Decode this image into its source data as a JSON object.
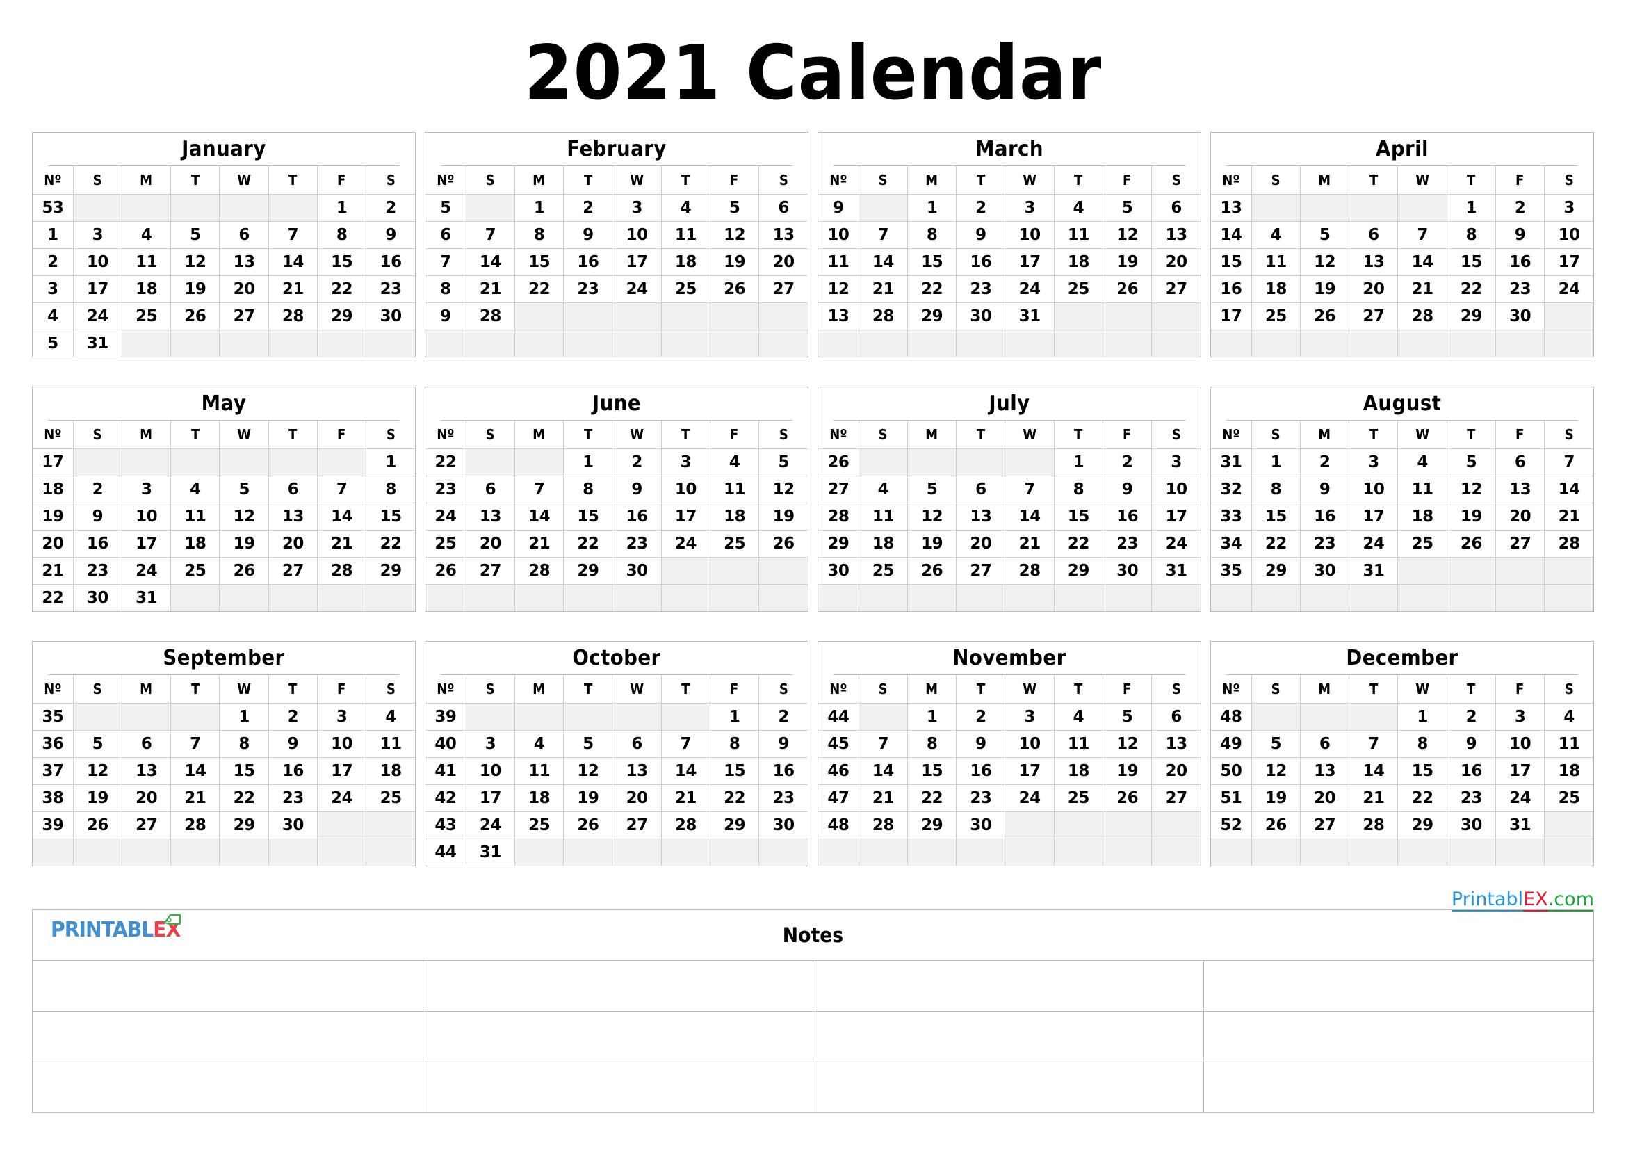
{
  "title": "2021 Calendar",
  "colors": {
    "sunday": "#c1272d",
    "saturday": "#1b75bb",
    "grid": "#bcbcbc",
    "blank_cell": "#f1f1f1",
    "logo_blue": "#3f8fd2",
    "logo_red": "#e8424c",
    "logo_green": "#3fae49",
    "watermark_blue": "#2196e0",
    "watermark_red": "#e8192c",
    "watermark_green": "#1aa536"
  },
  "weekday_headers": [
    "Nº",
    "S",
    "M",
    "T",
    "W",
    "T",
    "F",
    "S"
  ],
  "months": [
    {
      "name": "January",
      "weeks": [
        {
          "no": "53",
          "days": [
            "",
            "",
            "",
            "",
            "",
            "1",
            "2"
          ]
        },
        {
          "no": "1",
          "days": [
            "3",
            "4",
            "5",
            "6",
            "7",
            "8",
            "9"
          ]
        },
        {
          "no": "2",
          "days": [
            "10",
            "11",
            "12",
            "13",
            "14",
            "15",
            "16"
          ]
        },
        {
          "no": "3",
          "days": [
            "17",
            "18",
            "19",
            "20",
            "21",
            "22",
            "23"
          ]
        },
        {
          "no": "4",
          "days": [
            "24",
            "25",
            "26",
            "27",
            "28",
            "29",
            "30"
          ]
        },
        {
          "no": "5",
          "days": [
            "31",
            "",
            "",
            "",
            "",
            "",
            ""
          ]
        }
      ]
    },
    {
      "name": "February",
      "weeks": [
        {
          "no": "5",
          "days": [
            "",
            "1",
            "2",
            "3",
            "4",
            "5",
            "6"
          ]
        },
        {
          "no": "6",
          "days": [
            "7",
            "8",
            "9",
            "10",
            "11",
            "12",
            "13"
          ]
        },
        {
          "no": "7",
          "days": [
            "14",
            "15",
            "16",
            "17",
            "18",
            "19",
            "20"
          ]
        },
        {
          "no": "8",
          "days": [
            "21",
            "22",
            "23",
            "24",
            "25",
            "26",
            "27"
          ]
        },
        {
          "no": "9",
          "days": [
            "28",
            "",
            "",
            "",
            "",
            "",
            ""
          ]
        },
        {
          "no": "",
          "days": [
            "",
            "",
            "",
            "",
            "",
            "",
            ""
          ]
        }
      ]
    },
    {
      "name": "March",
      "weeks": [
        {
          "no": "9",
          "days": [
            "",
            "1",
            "2",
            "3",
            "4",
            "5",
            "6"
          ]
        },
        {
          "no": "10",
          "days": [
            "7",
            "8",
            "9",
            "10",
            "11",
            "12",
            "13"
          ]
        },
        {
          "no": "11",
          "days": [
            "14",
            "15",
            "16",
            "17",
            "18",
            "19",
            "20"
          ]
        },
        {
          "no": "12",
          "days": [
            "21",
            "22",
            "23",
            "24",
            "25",
            "26",
            "27"
          ]
        },
        {
          "no": "13",
          "days": [
            "28",
            "29",
            "30",
            "31",
            "",
            "",
            ""
          ]
        },
        {
          "no": "",
          "days": [
            "",
            "",
            "",
            "",
            "",
            "",
            ""
          ]
        }
      ]
    },
    {
      "name": "April",
      "weeks": [
        {
          "no": "13",
          "days": [
            "",
            "",
            "",
            "",
            "1",
            "2",
            "3"
          ]
        },
        {
          "no": "14",
          "days": [
            "4",
            "5",
            "6",
            "7",
            "8",
            "9",
            "10"
          ]
        },
        {
          "no": "15",
          "days": [
            "11",
            "12",
            "13",
            "14",
            "15",
            "16",
            "17"
          ]
        },
        {
          "no": "16",
          "days": [
            "18",
            "19",
            "20",
            "21",
            "22",
            "23",
            "24"
          ]
        },
        {
          "no": "17",
          "days": [
            "25",
            "26",
            "27",
            "28",
            "29",
            "30",
            ""
          ]
        },
        {
          "no": "",
          "days": [
            "",
            "",
            "",
            "",
            "",
            "",
            ""
          ]
        }
      ]
    },
    {
      "name": "May",
      "weeks": [
        {
          "no": "17",
          "days": [
            "",
            "",
            "",
            "",
            "",
            "",
            "1"
          ]
        },
        {
          "no": "18",
          "days": [
            "2",
            "3",
            "4",
            "5",
            "6",
            "7",
            "8"
          ]
        },
        {
          "no": "19",
          "days": [
            "9",
            "10",
            "11",
            "12",
            "13",
            "14",
            "15"
          ]
        },
        {
          "no": "20",
          "days": [
            "16",
            "17",
            "18",
            "19",
            "20",
            "21",
            "22"
          ]
        },
        {
          "no": "21",
          "days": [
            "23",
            "24",
            "25",
            "26",
            "27",
            "28",
            "29"
          ]
        },
        {
          "no": "22",
          "days": [
            "30",
            "31",
            "",
            "",
            "",
            "",
            ""
          ]
        }
      ]
    },
    {
      "name": "June",
      "weeks": [
        {
          "no": "22",
          "days": [
            "",
            "",
            "1",
            "2",
            "3",
            "4",
            "5"
          ]
        },
        {
          "no": "23",
          "days": [
            "6",
            "7",
            "8",
            "9",
            "10",
            "11",
            "12"
          ]
        },
        {
          "no": "24",
          "days": [
            "13",
            "14",
            "15",
            "16",
            "17",
            "18",
            "19"
          ]
        },
        {
          "no": "25",
          "days": [
            "20",
            "21",
            "22",
            "23",
            "24",
            "25",
            "26"
          ]
        },
        {
          "no": "26",
          "days": [
            "27",
            "28",
            "29",
            "30",
            "",
            "",
            ""
          ]
        },
        {
          "no": "",
          "days": [
            "",
            "",
            "",
            "",
            "",
            "",
            ""
          ]
        }
      ]
    },
    {
      "name": "July",
      "weeks": [
        {
          "no": "26",
          "days": [
            "",
            "",
            "",
            "",
            "1",
            "2",
            "3"
          ]
        },
        {
          "no": "27",
          "days": [
            "4",
            "5",
            "6",
            "7",
            "8",
            "9",
            "10"
          ]
        },
        {
          "no": "28",
          "days": [
            "11",
            "12",
            "13",
            "14",
            "15",
            "16",
            "17"
          ]
        },
        {
          "no": "29",
          "days": [
            "18",
            "19",
            "20",
            "21",
            "22",
            "23",
            "24"
          ]
        },
        {
          "no": "30",
          "days": [
            "25",
            "26",
            "27",
            "28",
            "29",
            "30",
            "31"
          ]
        },
        {
          "no": "",
          "days": [
            "",
            "",
            "",
            "",
            "",
            "",
            ""
          ]
        }
      ]
    },
    {
      "name": "August",
      "weeks": [
        {
          "no": "31",
          "days": [
            "1",
            "2",
            "3",
            "4",
            "5",
            "6",
            "7"
          ]
        },
        {
          "no": "32",
          "days": [
            "8",
            "9",
            "10",
            "11",
            "12",
            "13",
            "14"
          ]
        },
        {
          "no": "33",
          "days": [
            "15",
            "16",
            "17",
            "18",
            "19",
            "20",
            "21"
          ]
        },
        {
          "no": "34",
          "days": [
            "22",
            "23",
            "24",
            "25",
            "26",
            "27",
            "28"
          ]
        },
        {
          "no": "35",
          "days": [
            "29",
            "30",
            "31",
            "",
            "",
            "",
            ""
          ]
        },
        {
          "no": "",
          "days": [
            "",
            "",
            "",
            "",
            "",
            "",
            ""
          ]
        }
      ]
    },
    {
      "name": "September",
      "weeks": [
        {
          "no": "35",
          "days": [
            "",
            "",
            "",
            "1",
            "2",
            "3",
            "4"
          ]
        },
        {
          "no": "36",
          "days": [
            "5",
            "6",
            "7",
            "8",
            "9",
            "10",
            "11"
          ]
        },
        {
          "no": "37",
          "days": [
            "12",
            "13",
            "14",
            "15",
            "16",
            "17",
            "18"
          ]
        },
        {
          "no": "38",
          "days": [
            "19",
            "20",
            "21",
            "22",
            "23",
            "24",
            "25"
          ]
        },
        {
          "no": "39",
          "days": [
            "26",
            "27",
            "28",
            "29",
            "30",
            "",
            ""
          ]
        },
        {
          "no": "",
          "days": [
            "",
            "",
            "",
            "",
            "",
            "",
            ""
          ]
        }
      ]
    },
    {
      "name": "October",
      "weeks": [
        {
          "no": "39",
          "days": [
            "",
            "",
            "",
            "",
            "",
            "1",
            "2"
          ]
        },
        {
          "no": "40",
          "days": [
            "3",
            "4",
            "5",
            "6",
            "7",
            "8",
            "9"
          ]
        },
        {
          "no": "41",
          "days": [
            "10",
            "11",
            "12",
            "13",
            "14",
            "15",
            "16"
          ]
        },
        {
          "no": "42",
          "days": [
            "17",
            "18",
            "19",
            "20",
            "21",
            "22",
            "23"
          ]
        },
        {
          "no": "43",
          "days": [
            "24",
            "25",
            "26",
            "27",
            "28",
            "29",
            "30"
          ]
        },
        {
          "no": "44",
          "days": [
            "31",
            "",
            "",
            "",
            "",
            "",
            ""
          ]
        }
      ]
    },
    {
      "name": "November",
      "weeks": [
        {
          "no": "44",
          "days": [
            "",
            "1",
            "2",
            "3",
            "4",
            "5",
            "6"
          ]
        },
        {
          "no": "45",
          "days": [
            "7",
            "8",
            "9",
            "10",
            "11",
            "12",
            "13"
          ]
        },
        {
          "no": "46",
          "days": [
            "14",
            "15",
            "16",
            "17",
            "18",
            "19",
            "20"
          ]
        },
        {
          "no": "47",
          "days": [
            "21",
            "22",
            "23",
            "24",
            "25",
            "26",
            "27"
          ]
        },
        {
          "no": "48",
          "days": [
            "28",
            "29",
            "30",
            "",
            "",
            "",
            ""
          ]
        },
        {
          "no": "",
          "days": [
            "",
            "",
            "",
            "",
            "",
            "",
            ""
          ]
        }
      ]
    },
    {
      "name": "December",
      "weeks": [
        {
          "no": "48",
          "days": [
            "",
            "",
            "",
            "1",
            "2",
            "3",
            "4"
          ]
        },
        {
          "no": "49",
          "days": [
            "5",
            "6",
            "7",
            "8",
            "9",
            "10",
            "11"
          ]
        },
        {
          "no": "50",
          "days": [
            "12",
            "13",
            "14",
            "15",
            "16",
            "17",
            "18"
          ]
        },
        {
          "no": "51",
          "days": [
            "19",
            "20",
            "21",
            "22",
            "23",
            "24",
            "25"
          ]
        },
        {
          "no": "52",
          "days": [
            "26",
            "27",
            "28",
            "29",
            "30",
            "31",
            ""
          ]
        },
        {
          "no": "",
          "days": [
            "",
            "",
            "",
            "",
            "",
            "",
            ""
          ]
        }
      ]
    }
  ],
  "watermark": {
    "part1": "Printabl",
    "part2": "EX",
    "part3": ".com"
  },
  "notes": {
    "label": "Notes",
    "rows": 3,
    "columns": 4,
    "logo": {
      "text_main": "PRINTABL",
      "text_accent": "EX",
      "flag_icon": "tag-flag-icon"
    }
  }
}
